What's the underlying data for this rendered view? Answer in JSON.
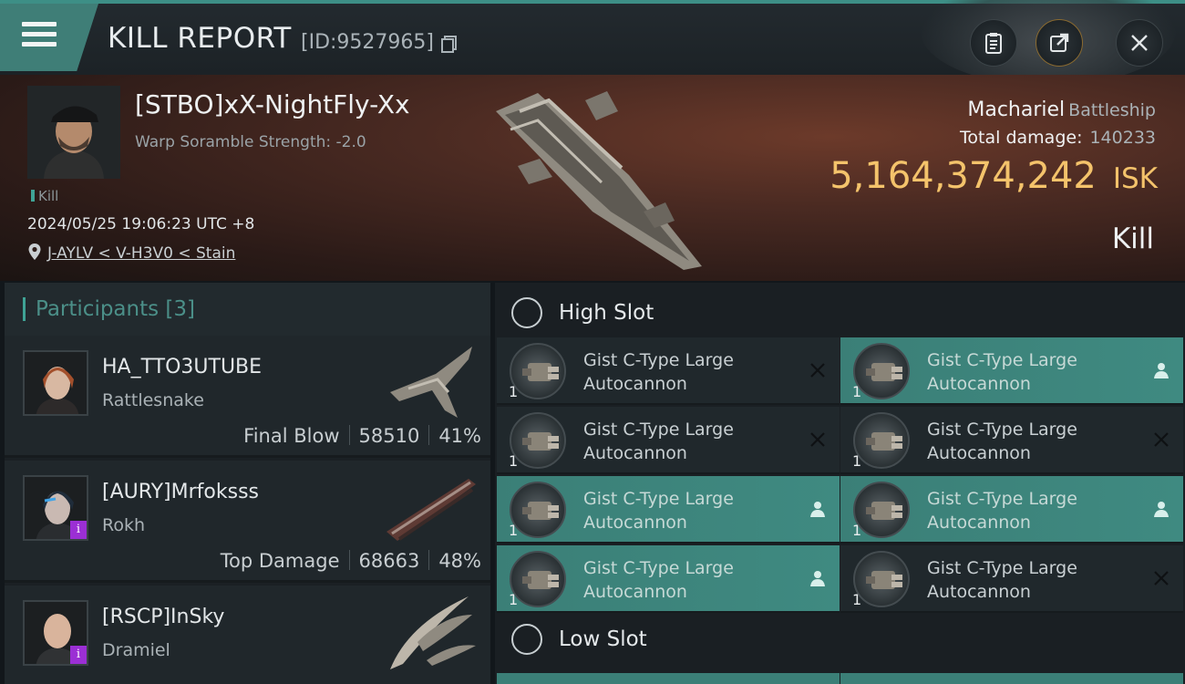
{
  "header": {
    "title": "KILL REPORT",
    "id_label": "[ID:9527965]",
    "accent_color": "#3d8f86"
  },
  "victim": {
    "name": "[STBO]xX-NightFly-Xx",
    "warp_scramble": "Warp Soramble Strength: -2.0",
    "tag": "Kill",
    "datetime": "2024/05/25 19:06:23 UTC +8",
    "location": "J-AYLV < V-H3V0 < Stain",
    "ship": "Machariel",
    "ship_class": "Battleship",
    "total_damage_label": "Total damage:",
    "total_damage": "140233",
    "isk_value": "5,164,374,242",
    "isk_unit": "ISK",
    "result": "Kill",
    "isk_color": "#f4c36b"
  },
  "participants": {
    "header": "Participants [3]",
    "items": [
      {
        "name": "HA_TTO3UTUBE",
        "ship": "Rattlesnake",
        "role": "Final Blow",
        "damage": "58510",
        "percent": "41%",
        "badge": ""
      },
      {
        "name": "[AURY]Mrfoksss",
        "ship": "Rokh",
        "role": "Top Damage",
        "damage": "68663",
        "percent": "48%",
        "badge": "i"
      },
      {
        "name": "[RSCP]InSky",
        "ship": "Dramiel",
        "role": "",
        "damage": "",
        "percent": "",
        "badge": "i"
      }
    ]
  },
  "slots": {
    "high_title": "High Slot",
    "low_title": "Low Slot",
    "high_modules": [
      {
        "name": "Gist C-Type Large Autocannon",
        "qty": "1",
        "status": "destroyed-icon",
        "fitted": false
      },
      {
        "name": "Gist C-Type Large Autocannon",
        "qty": "1",
        "status": "dropped-icon",
        "fitted": true
      },
      {
        "name": "Gist C-Type Large Autocannon",
        "qty": "1",
        "status": "destroyed-icon",
        "fitted": false
      },
      {
        "name": "Gist C-Type Large Autocannon",
        "qty": "1",
        "status": "destroyed-icon",
        "fitted": false
      },
      {
        "name": "Gist C-Type Large Autocannon",
        "qty": "1",
        "status": "dropped-icon",
        "fitted": true
      },
      {
        "name": "Gist C-Type Large Autocannon",
        "qty": "1",
        "status": "dropped-icon",
        "fitted": true
      },
      {
        "name": "Gist C-Type Large Autocannon",
        "qty": "1",
        "status": "dropped-icon",
        "fitted": true
      },
      {
        "name": "Gist C-Type Large Autocannon",
        "qty": "1",
        "status": "destroyed-icon",
        "fitted": false
      }
    ]
  }
}
